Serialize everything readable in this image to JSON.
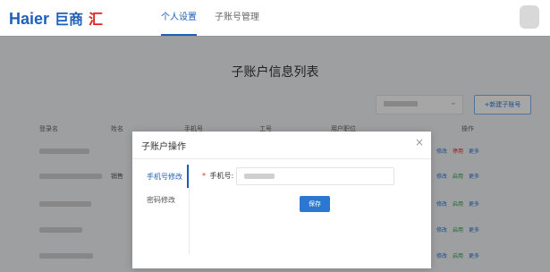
{
  "brand": {
    "name": "Haier",
    "sub_zh_blue": "巨商",
    "sub_zh_red": "汇"
  },
  "nav": {
    "tabs": [
      {
        "label": "个人设置"
      },
      {
        "label": "子账号管理"
      }
    ]
  },
  "page": {
    "title": "子账户信息列表"
  },
  "filters": {
    "add_button": "+新建子账号"
  },
  "table": {
    "headers": [
      "登录名",
      "姓名",
      "手机号",
      "工号",
      "用户职位",
      "操作"
    ],
    "rows": [
      {
        "name": "",
        "ops": [
          "修改",
          "停用",
          "更多"
        ],
        "second_op_type": "disable"
      },
      {
        "name": "销售",
        "ops": [
          "修改",
          "启用",
          "更多"
        ],
        "second_op_type": "enable"
      },
      {
        "name": "",
        "ops": [
          "修改",
          "启用",
          "更多"
        ],
        "second_op_type": "enable"
      },
      {
        "name": "",
        "ops": [
          "修改",
          "启用",
          "更多"
        ],
        "second_op_type": "enable"
      },
      {
        "name": "",
        "ops": [
          "修改",
          "启用",
          "更多"
        ],
        "second_op_type": "enable"
      }
    ]
  },
  "modal": {
    "title": "子账户操作",
    "close_icon": "×",
    "menu": [
      {
        "label": "手机号修改",
        "active": true
      },
      {
        "label": "密码修改",
        "active": false
      }
    ],
    "form": {
      "label": "手机号:",
      "required_mark": "*",
      "value": ""
    },
    "save_button": "保存"
  }
}
